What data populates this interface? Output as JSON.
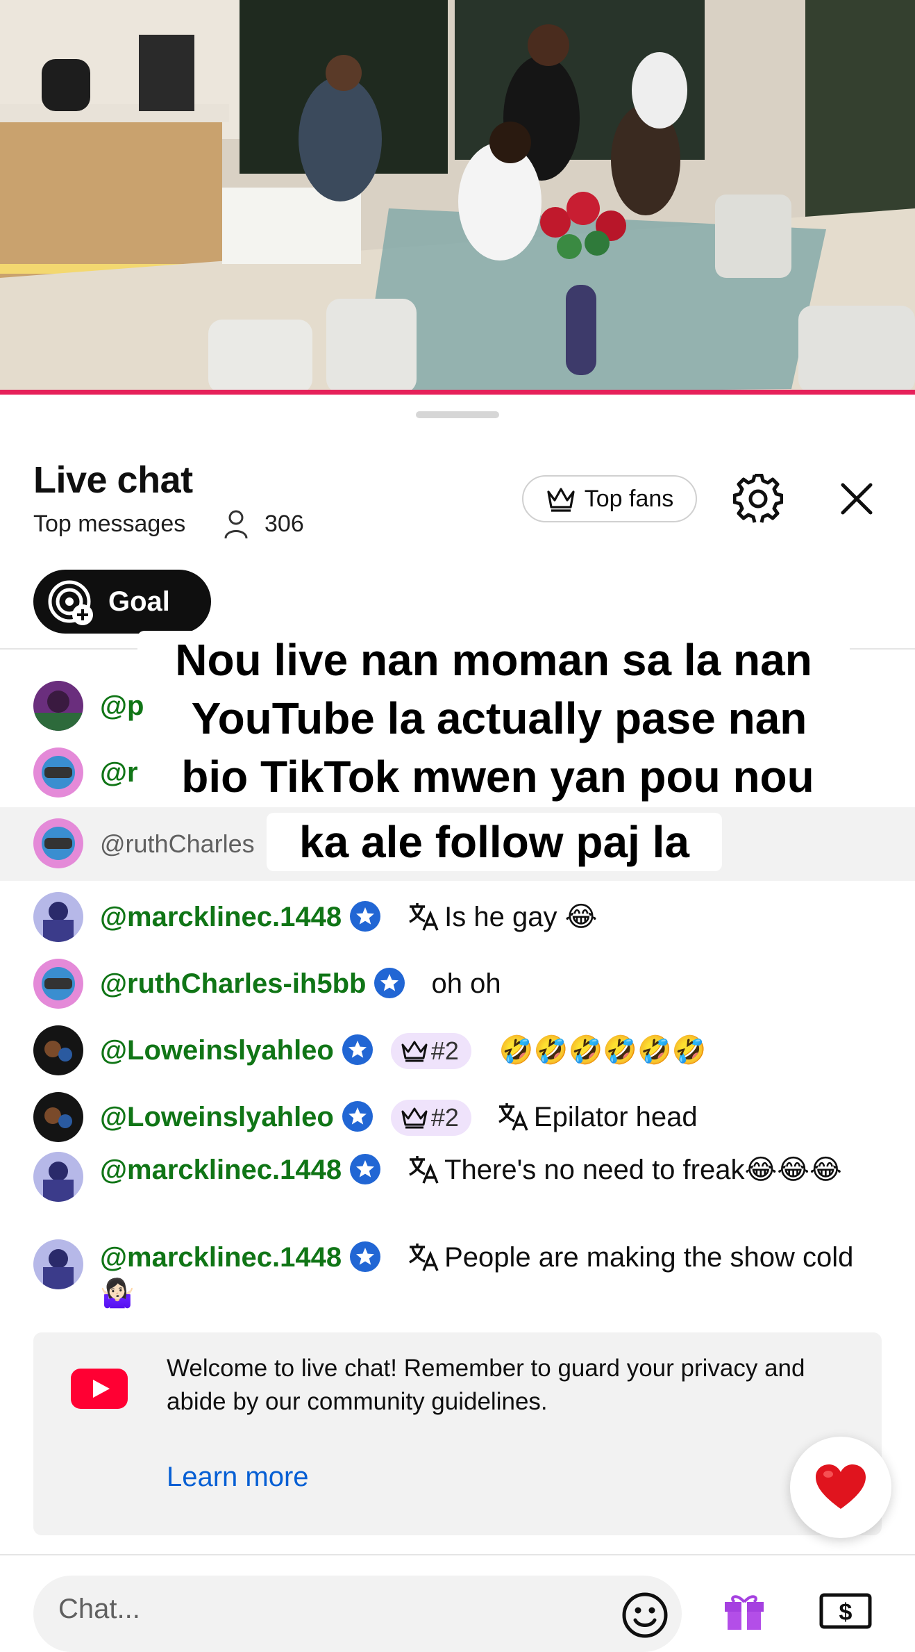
{
  "header": {
    "title": "Live chat",
    "subtitle": "Top messages",
    "viewer_count": "306",
    "top_fans_label": "Top fans",
    "goal_label": "Goal"
  },
  "overlay_caption": {
    "line1": "Nou live nan moman sa la nan",
    "line2": "YouTube la  actually pase nan",
    "line3": "bio TikTok mwen yan pou nou",
    "line4": "ka ale follow paj la"
  },
  "messages": [
    {
      "author": "@p",
      "text": ""
    },
    {
      "author": "@r",
      "text": ""
    },
    {
      "author": "@ruthCharles",
      "text": ""
    },
    {
      "author": "@marcklinec.1448",
      "text": "Is he gay 😂"
    },
    {
      "author": "@ruthCharles-ih5bb",
      "text": "oh oh"
    },
    {
      "author": "@Loweinslyahleo",
      "badge": "#2",
      "text": "🤣🤣🤣🤣🤣🤣"
    },
    {
      "author": "@Loweinslyahleo",
      "badge": "#2",
      "text": "Epilator head"
    },
    {
      "author": "@marcklinec.1448",
      "text": "There's no need to freak😂😂😂"
    },
    {
      "author": "@marcklinec.1448",
      "text": "People are making the show cold🤷🏻‍♀️"
    }
  ],
  "welcome": {
    "text": "Welcome to live chat! Remember to guard your privacy and abide by our community guidelines.",
    "link": "Learn more"
  },
  "reaction": {
    "emoji": "❤️"
  },
  "chat_input": {
    "placeholder": "Chat..."
  },
  "colors": {
    "author_green": "#107516",
    "progress_red": "#e6215a",
    "link_blue": "#065fd4",
    "badge_purple": "#efe3fb"
  },
  "icons": [
    "person-icon",
    "crown-icon",
    "gear-icon",
    "close-icon",
    "goal-icon",
    "verified-icon",
    "translate-icon",
    "youtube-logo",
    "heart-icon",
    "emoji-icon",
    "gift-icon",
    "money-icon"
  ]
}
